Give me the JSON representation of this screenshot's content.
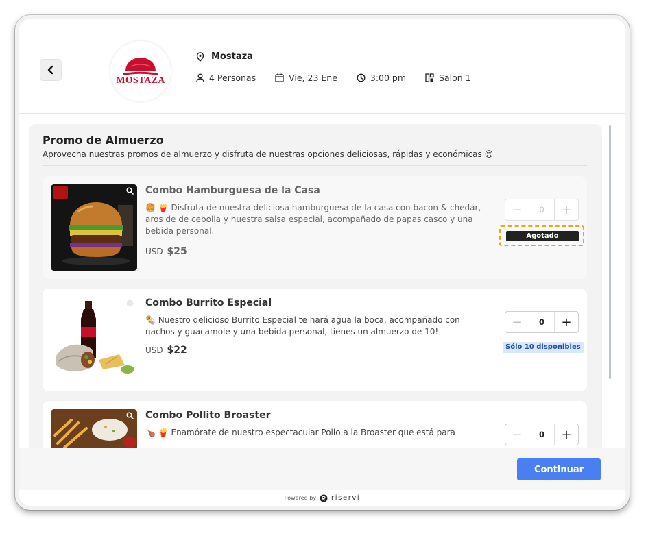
{
  "header": {
    "back_label": "",
    "logo_text": "MOSTAZA",
    "venue_name": "Mostaza",
    "people": "4 Personas",
    "date": "Vie, 23 Ene",
    "time": "3:00 pm",
    "room": "Salon 1"
  },
  "section": {
    "title": "Promo de Almuerzo",
    "description": "Aprovecha nuestras promos de almuerzo y disfruta de nuestras opciones deliciosas, rápidas y económicas 😍"
  },
  "items": [
    {
      "title": "Combo Hamburguesa de la Casa",
      "description": "🍔 🍟 Disfruta de nuestra deliciosa hamburguesa de la casa con bacon & chedar, aros de de cebolla y nuestra salsa especial, acompañado de papas casco y una bebida personal.",
      "currency": "USD",
      "price": "$25",
      "quantity": "0",
      "status": "Agotado",
      "sold_out": true
    },
    {
      "title": "Combo Burrito Especial",
      "description": "🌯 Nuestro delicioso Burrito Especial te hará agua la boca, acompañado con nachos y guacamole y una bebida personal, tienes un almuerzo de 10!",
      "currency": "USD",
      "price": "$22",
      "quantity": "0",
      "status": "Sólo 10 disponibles",
      "sold_out": false
    },
    {
      "title": "Combo Pollito Broaster",
      "description": "🍗 🍟 Enamórate de nuestro espectacular Pollo a la Broaster que está para",
      "quantity": "0",
      "sold_out": false
    }
  ],
  "footer": {
    "continue_label": "Continuar",
    "powered_by": "Powered by",
    "brand": "riservi"
  },
  "colors": {
    "accent": "#4a7ef3",
    "brand_red": "#c8102e",
    "soldout_outline": "#e6a817",
    "available_badge_bg": "#dbe8fb"
  },
  "icons": {
    "back": "chevron-left-icon",
    "venue": "location-pin-icon",
    "people": "person-icon",
    "date": "calendar-icon",
    "time": "clock-icon",
    "room": "room-icon",
    "zoom": "magnifier-icon"
  }
}
